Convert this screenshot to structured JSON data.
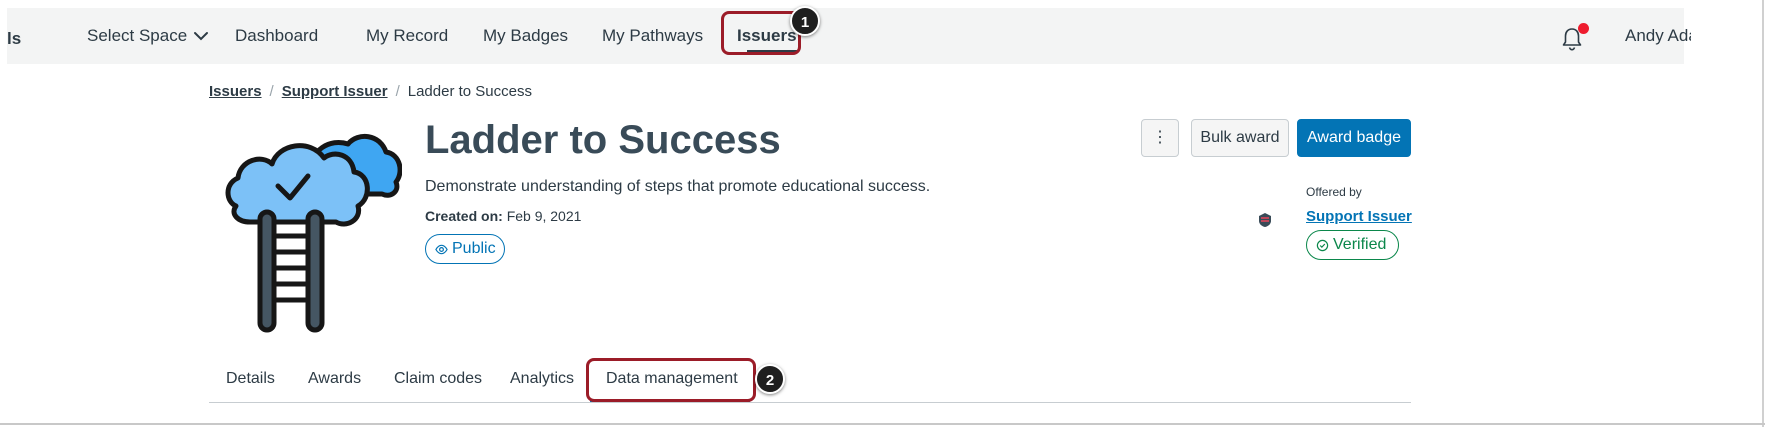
{
  "topnav": {
    "brand_fragment": "ls",
    "select_space": "Select Space",
    "items": [
      {
        "label": "Dashboard"
      },
      {
        "label": "My Record"
      },
      {
        "label": "My Badges"
      },
      {
        "label": "My Pathways"
      },
      {
        "label": "Issuers"
      }
    ],
    "active": "Issuers",
    "user_name": "Andy Adams",
    "notification_dot_color": "#ee1c2e"
  },
  "callouts": [
    "1",
    "2"
  ],
  "breadcrumb": {
    "items": [
      "Issuers",
      "Support Issuer"
    ],
    "current": "Ladder to Success",
    "separator": "/"
  },
  "badge": {
    "title": "Ladder to Success",
    "description": "Demonstrate understanding of steps that promote educational success.",
    "created_label": "Created on:",
    "created_value": "Feb 9, 2021",
    "visibility": "Public",
    "image_icon": "cloud-ladder-badge-icon"
  },
  "actions": {
    "more_label": "⋮",
    "bulk_award": "Bulk award",
    "award_badge": "Award badge"
  },
  "offered_by": {
    "label": "Offered by",
    "issuer": "Support Issuer",
    "status": "Verified"
  },
  "tabs": [
    {
      "label": "Details"
    },
    {
      "label": "Awards"
    },
    {
      "label": "Claim codes"
    },
    {
      "label": "Analytics"
    },
    {
      "label": "Data management"
    }
  ],
  "active_tab": "Data management",
  "colors": {
    "accent": "#0374b5",
    "verified": "#0b874b",
    "callout_border": "#9b1c28"
  }
}
